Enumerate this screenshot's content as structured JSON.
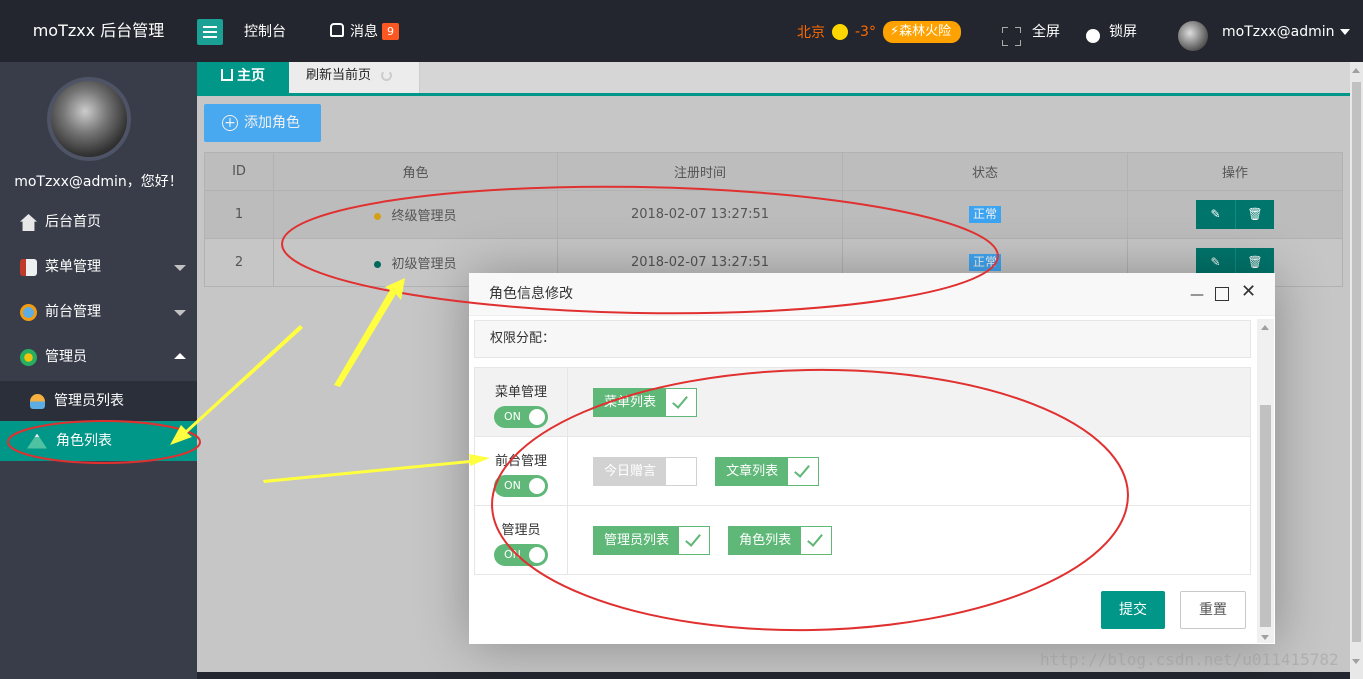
{
  "header": {
    "logo": "moTzxx 后台管理",
    "nav_console": "控制台",
    "nav_message": "消息",
    "message_count": "9",
    "weather_city": "北京",
    "weather_temp": "-3°",
    "weather_alert": "森林火险",
    "fullscreen": "全屏",
    "lock": "锁屏",
    "user": "moTzxx@admin"
  },
  "sidebar": {
    "welcome": "moTzxx@admin，您好！",
    "items": [
      {
        "label": "后台首页"
      },
      {
        "label": "菜单管理"
      },
      {
        "label": "前台管理"
      },
      {
        "label": "管理员"
      }
    ],
    "sub_items": [
      {
        "label": "管理员列表"
      },
      {
        "label": "角色列表"
      }
    ]
  },
  "tabs": {
    "home": "主页",
    "refresh": "刷新当前页"
  },
  "toolbar": {
    "add_role": "添加角色"
  },
  "table": {
    "columns": [
      "ID",
      "角色",
      "注册时间",
      "状态",
      "操作"
    ],
    "rows": [
      {
        "id": "1",
        "role": "终级管理员",
        "time": "2018-02-07 13:27:51",
        "status": "正常"
      },
      {
        "id": "2",
        "role": "初级管理员",
        "time": "2018-02-07 13:27:51",
        "status": "正常"
      }
    ]
  },
  "dialog": {
    "title": "角色信息修改",
    "perm_label": "权限分配：",
    "groups": [
      {
        "name": "菜单管理",
        "switch": "ON",
        "items": [
          {
            "label": "菜单列表",
            "checked": true
          }
        ]
      },
      {
        "name": "前台管理",
        "switch": "ON",
        "items": [
          {
            "label": "今日赠言",
            "checked": false
          },
          {
            "label": "文章列表",
            "checked": true
          }
        ]
      },
      {
        "name": "管理员",
        "switch": "ON",
        "items": [
          {
            "label": "管理员列表",
            "checked": true
          },
          {
            "label": "角色列表",
            "checked": true
          }
        ]
      }
    ],
    "submit": "提交",
    "reset": "重置"
  },
  "watermark": "http://blog.csdn.net/u011415782",
  "colors": {
    "primary": "#009688",
    "accent_green": "#5fb878",
    "blue": "#1e9fff",
    "annotation_red": "#e03030",
    "annotation_yellow": "#ffff40"
  }
}
